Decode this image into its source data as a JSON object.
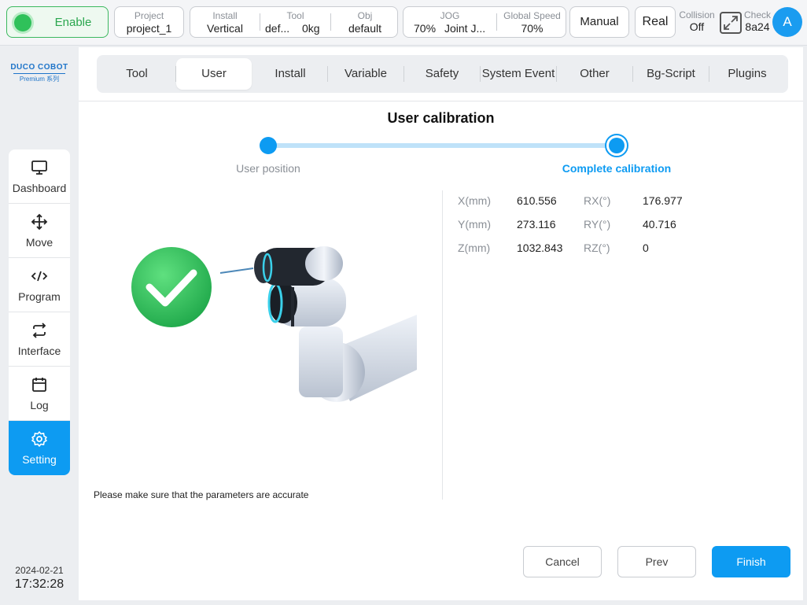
{
  "topbar": {
    "enable_label": "Enable",
    "project": {
      "caption": "Project",
      "value": "project_1"
    },
    "install": {
      "caption": "Install",
      "value": "Vertical"
    },
    "tool": {
      "caption": "Tool",
      "value_name": "def...",
      "value_load": "0kg"
    },
    "obj": {
      "caption": "Obj",
      "value": "default"
    },
    "jog": {
      "caption": "JOG",
      "value_speed": "70%",
      "value_mode": "Joint J..."
    },
    "global_speed": {
      "caption": "Global Speed",
      "value": "70%"
    },
    "mode_label": "Manual",
    "real_label": "Real",
    "collision": {
      "caption": "Collision",
      "value": "Off"
    },
    "check": {
      "caption": "Check",
      "value": "8a24"
    },
    "avatar_letter": "A"
  },
  "logo": {
    "line1": "DUCO COBOT",
    "line2": "Premium 系列"
  },
  "sidebar": {
    "items": [
      {
        "label": "Dashboard",
        "icon": "monitor-icon"
      },
      {
        "label": "Move",
        "icon": "move-arrows-icon"
      },
      {
        "label": "Program",
        "icon": "code-icon"
      },
      {
        "label": "Interface",
        "icon": "swap-icon"
      },
      {
        "label": "Log",
        "icon": "calendar-icon"
      },
      {
        "label": "Setting",
        "icon": "gear-icon"
      }
    ],
    "active_index": 5
  },
  "datetime": {
    "date": "2024-02-21",
    "time": "17:32:28"
  },
  "tabs": [
    {
      "label": "Tool"
    },
    {
      "label": "User"
    },
    {
      "label": "Install"
    },
    {
      "label": "Variable"
    },
    {
      "label": "Safety"
    },
    {
      "label": "System Event"
    },
    {
      "label": "Other"
    },
    {
      "label": "Bg-Script"
    },
    {
      "label": "Plugins"
    }
  ],
  "active_tab": 1,
  "content": {
    "title": "User calibration",
    "steps": [
      {
        "label": "User position"
      },
      {
        "label": "Complete calibration"
      }
    ],
    "params": [
      {
        "label_a": "X(mm)",
        "value_a": "610.556",
        "label_b": "RX(°)",
        "value_b": "176.977"
      },
      {
        "label_a": "Y(mm)",
        "value_a": "273.116",
        "label_b": "RY(°)",
        "value_b": "40.716"
      },
      {
        "label_a": "Z(mm)",
        "value_a": "1032.843",
        "label_b": "RZ(°)",
        "value_b": "0"
      }
    ],
    "notice": "Please make sure that the parameters are accurate",
    "buttons": {
      "cancel": "Cancel",
      "prev": "Prev",
      "finish": "Finish"
    }
  },
  "colors": {
    "accent": "#0d9bf2",
    "enable_green": "#2fc15a",
    "check_green": "#34c759"
  }
}
